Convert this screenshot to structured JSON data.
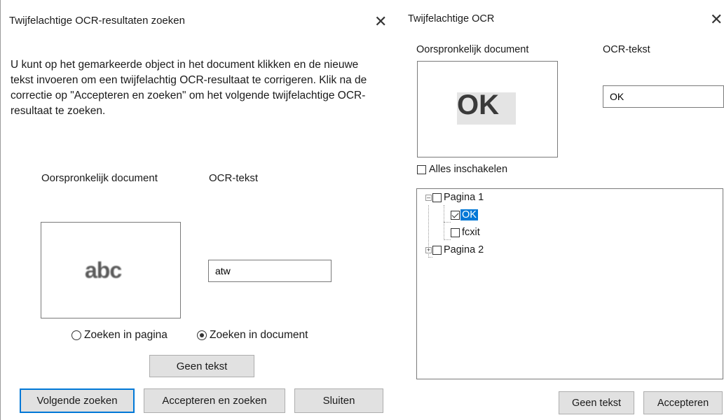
{
  "left_dialog": {
    "title": "Twijfelachtige OCR-resultaten zoeken",
    "description": "U kunt op het gemarkeerde object in het document klikken en de nieuwe tekst invoeren om een twijfelachtig OCR-resultaat te corrigeren. Klik na de correctie op \"Accepteren en zoeken\" om het volgende twijfelachtige OCR-resultaat te zoeken.",
    "original_label": "Oorspronkelijk document",
    "ocr_label": "OCR-tekst",
    "preview_text": "abc",
    "ocr_value": "atw",
    "radio_page": "Zoeken in pagina",
    "radio_document": "Zoeken in document",
    "radio_selected": "document",
    "no_text_button": "Geen tekst",
    "find_next_button": "Volgende zoeken",
    "accept_find_button": "Accepteren en zoeken",
    "close_button": "Sluiten"
  },
  "right_dialog": {
    "title": "Twijfelachtige OCR",
    "original_label": "Oorspronkelijk document",
    "ocr_label": "OCR-tekst",
    "preview_text": "OK",
    "ocr_value": "OK",
    "enable_all_label": "Alles inschakelen",
    "tree": {
      "page1": "Pagina 1",
      "item_ok": "OK",
      "item_fcxit": "fcxit",
      "page2": "Pagina 2"
    },
    "no_text_button": "Geen tekst",
    "accept_button": "Accepteren"
  },
  "colors": {
    "accent": "#0078d7",
    "button_bg": "#e1e1e1",
    "border": "#7a7a7a"
  }
}
